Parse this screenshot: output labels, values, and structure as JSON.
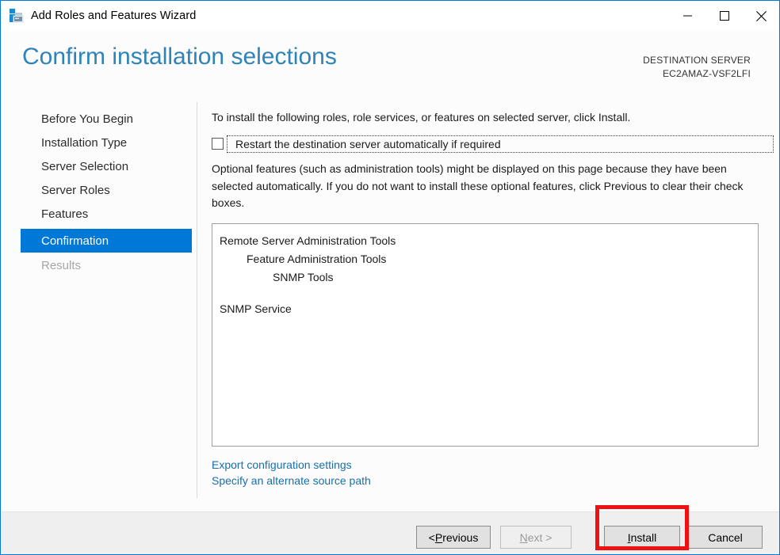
{
  "window": {
    "title": "Add Roles and Features Wizard",
    "icon": "server-roles-icon",
    "accent_color": "#0078d7",
    "caption": {
      "minimize_label": "Minimize",
      "maximize_label": "Maximize",
      "close_label": "Close"
    }
  },
  "header": {
    "page_title": "Confirm installation selections",
    "title_color": "#2e83b8",
    "destination_label": "DESTINATION SERVER",
    "destination_server": "EC2AMAZ-VSF2LFI"
  },
  "sidebar": {
    "items": [
      {
        "label": "Before You Begin",
        "state": "normal"
      },
      {
        "label": "Installation Type",
        "state": "normal"
      },
      {
        "label": "Server Selection",
        "state": "normal"
      },
      {
        "label": "Server Roles",
        "state": "normal"
      },
      {
        "label": "Features",
        "state": "normal"
      },
      {
        "label": "Confirmation",
        "state": "selected"
      },
      {
        "label": "Results",
        "state": "disabled"
      }
    ],
    "selected_color": "#0078d7"
  },
  "content": {
    "intro_text": "To install the following roles, role services, or features on selected server, click Install.",
    "restart_checkbox": {
      "label": "Restart the destination server automatically if required",
      "checked": false,
      "focused": true
    },
    "optional_text": "Optional features (such as administration tools) might be displayed on this page because they have been selected automatically. If you do not want to install these optional features, click Previous to clear their check boxes.",
    "feature_list": [
      {
        "text": "Remote Server Administration Tools",
        "indent": 0
      },
      {
        "text": "Feature Administration Tools",
        "indent": 1
      },
      {
        "text": "SNMP Tools",
        "indent": 2
      },
      {
        "text": "",
        "indent": 0
      },
      {
        "text": "SNMP Service",
        "indent": 0
      }
    ],
    "links": [
      {
        "text": "Export configuration settings"
      },
      {
        "text": "Specify an alternate source path"
      }
    ],
    "link_color": "#1a6fa8"
  },
  "footer": {
    "buttons": [
      {
        "name": "previous",
        "prefix": "< ",
        "accesskey": "P",
        "suffix": "revious",
        "disabled": false
      },
      {
        "name": "next",
        "prefix": "",
        "accesskey": "N",
        "suffix": "ext >",
        "disabled": true
      },
      {
        "name": "install",
        "prefix": "",
        "accesskey": "I",
        "suffix": "nstall",
        "disabled": false
      },
      {
        "name": "cancel",
        "prefix": "",
        "accesskey": "",
        "suffix": "Cancel",
        "disabled": false
      }
    ],
    "highlight_color": "#ee1111",
    "highlighted_button": "install"
  }
}
